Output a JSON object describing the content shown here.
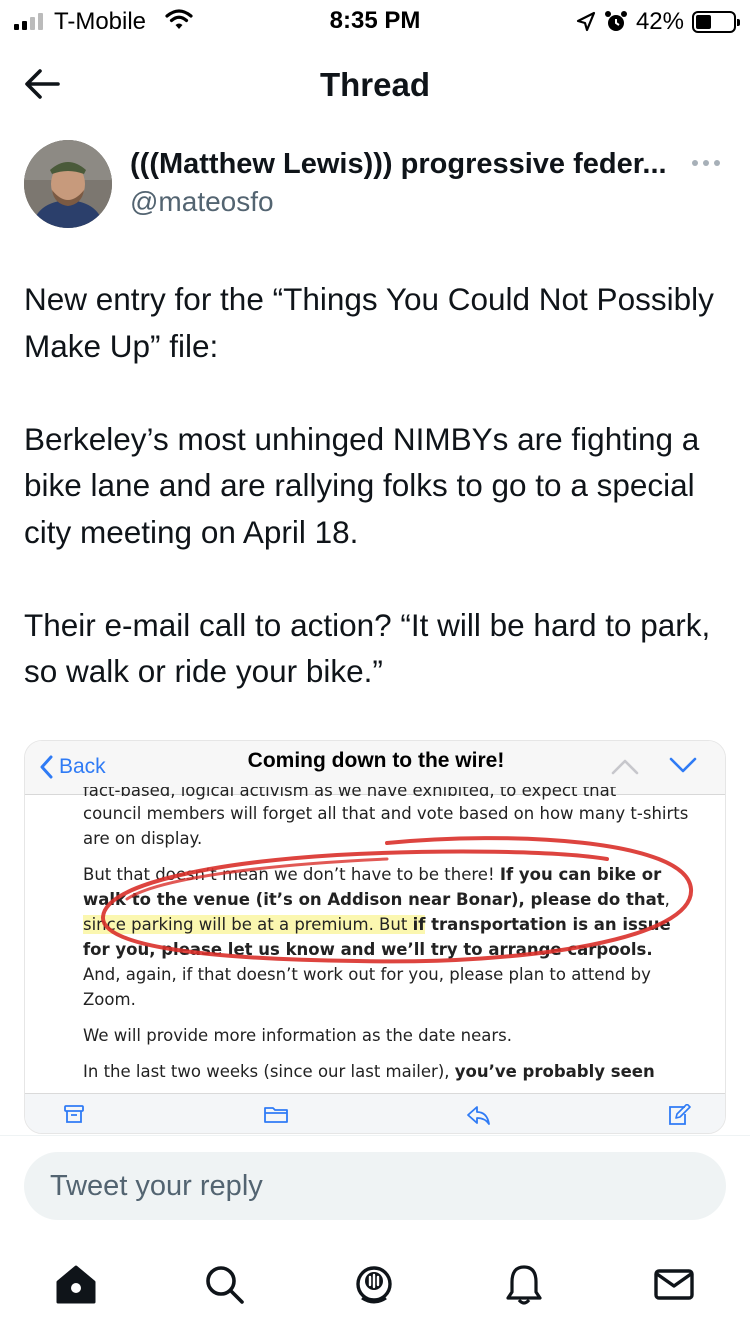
{
  "status_bar": {
    "carrier": "T-Mobile",
    "time": "8:35 PM",
    "battery_percent": "42%",
    "battery_level": 0.42,
    "signal_bars": 2
  },
  "header": {
    "title": "Thread",
    "back_icon": "arrow-left-icon"
  },
  "author": {
    "name": "(((Matthew Lewis))) progressive feder...",
    "handle": "@mateosfo",
    "more_icon": "more-horizontal-icon"
  },
  "tweet": {
    "paragraphs": [
      "New entry for the “Things You Could Not Possibly Make Up” file:",
      "Berkeley’s most unhinged NIMBYs are fighting a bike lane and are rallying folks to go to a special city meeting on April 18.",
      "Their e-mail call to action? “It will be hard to park, so walk or ride your bike.”"
    ]
  },
  "media": {
    "back_label": "Back",
    "subject": "Coming down to the wire!",
    "body": {
      "p1_cut": "fact-based, logical activism as we have exhibited, to expect that",
      "p1_rest": "council members will forget all that and vote based on how many t-shirts are on display.",
      "p2_a": "But that doesn’t mean we don’t have to be there! ",
      "p2_b": "If you can bike or walk to the venue (it’s on Addison near Bonar), please do that",
      "p2_c": ", ",
      "p2_hl": "since parking will be at a premium. But ",
      "p2_hl_b": "if",
      "p2_d": " transportation is an issue for you, please let us know and we’ll try to arrange carpools.",
      "p2_e": " And, again, if that doesn’t work out for you, please plan to attend by Zoom.",
      "p3": "We will provide more information as the date nears.",
      "p4_a": "In the last two weeks (since our last mailer), ",
      "p4_b": "you’ve probably seen"
    },
    "toolbar_icons": [
      "archive-icon",
      "folder-icon",
      "reply-icon",
      "compose-icon"
    ]
  },
  "reply": {
    "placeholder": "Tweet your reply"
  },
  "bottom_nav": {
    "items": [
      "home-icon",
      "search-icon",
      "spaces-icon",
      "notifications-icon",
      "messages-icon"
    ]
  },
  "colors": {
    "text_primary": "#0f1419",
    "text_secondary": "#536471",
    "mail_accent": "#2f7bf5",
    "annotation_red": "#d9302a",
    "highlight": "#fbf7b0"
  }
}
